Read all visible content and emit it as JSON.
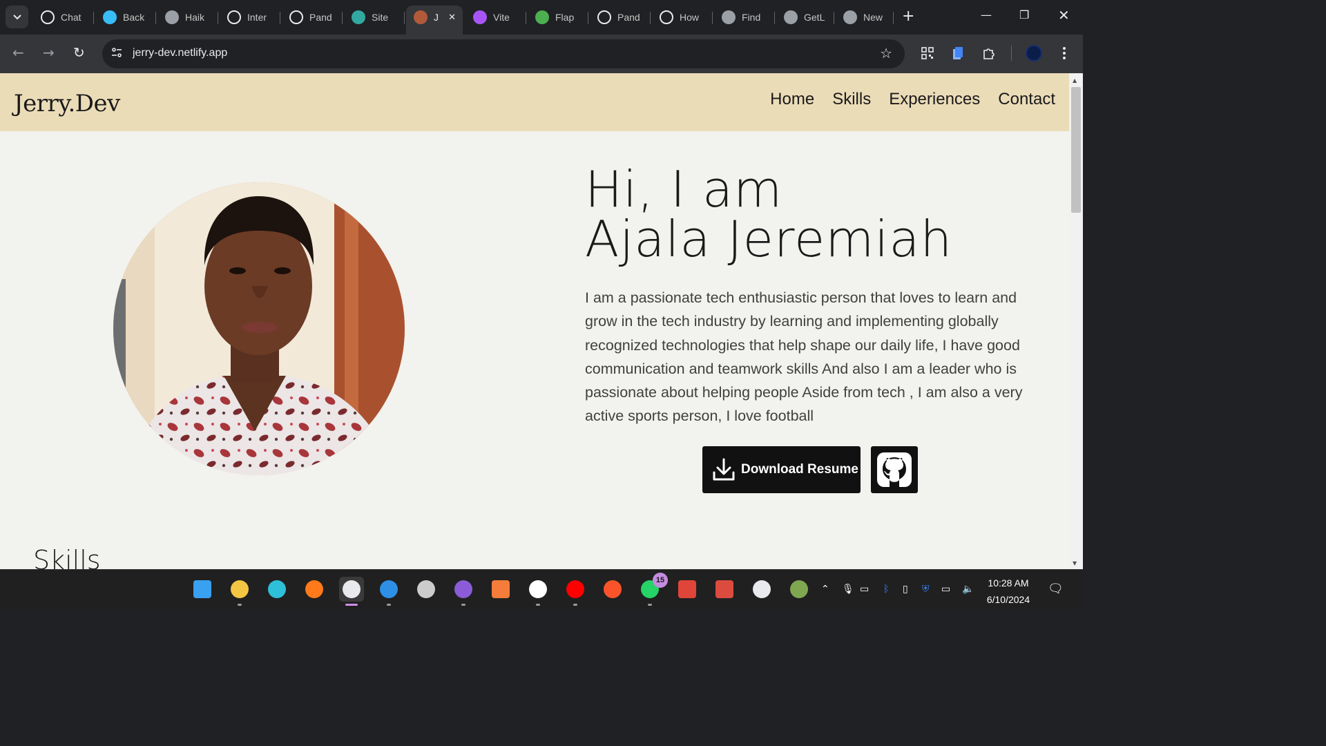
{
  "browser": {
    "tabs": [
      {
        "label": "Chat",
        "icon": "chatgpt-icon",
        "color": "#ffffff"
      },
      {
        "label": "Back",
        "icon": "tailwind-icon",
        "color": "#38bdf8"
      },
      {
        "label": "Haik",
        "icon": "globe-icon",
        "color": "#9aa0a6"
      },
      {
        "label": "Inter",
        "icon": "medium-icon",
        "color": "#ffffff"
      },
      {
        "label": "Pand",
        "icon": "panda-icon",
        "color": "#ffffff"
      },
      {
        "label": "Site",
        "icon": "netlify-icon",
        "color": "#32a8a1"
      },
      {
        "label": "J",
        "icon": "profile-photo-icon",
        "color": "#b05a3a"
      },
      {
        "label": "Vite",
        "icon": "vite-icon",
        "color": "#a855f7"
      },
      {
        "label": "Flap",
        "icon": "game-icon",
        "color": "#4caf50"
      },
      {
        "label": "Pand",
        "icon": "panda-icon",
        "color": "#ffffff"
      },
      {
        "label": "How",
        "icon": "medium-icon",
        "color": "#ffffff"
      },
      {
        "label": "Find",
        "icon": "globe-icon",
        "color": "#9aa0a6"
      },
      {
        "label": "GetL",
        "icon": "globe-icon",
        "color": "#9aa0a6"
      },
      {
        "label": "New",
        "icon": "chrome-icon",
        "color": "#9aa0a6"
      }
    ],
    "active_tab_index": 6,
    "url": "jerry-dev.netlify.app"
  },
  "site": {
    "brand": "Jerry.Dev",
    "nav": [
      "Home",
      "Skills",
      "Experiences",
      "Contact"
    ],
    "hero": {
      "line1": "Hi, I am",
      "line2": "Ajala Jeremiah",
      "bio": "I am a passionate tech enthusiastic person that loves to learn and grow in the tech industry by learning and implementing globally recognized technologies that help shape our daily life, I have good communication and teamwork skills And also I am a leader who is passionate about helping people Aside from tech , I am also a very active sports person, I love football",
      "resume_button": "Download Resume"
    },
    "skills_heading": "Skills",
    "colors": {
      "header_bg": "#ebdcb8",
      "page_bg": "#f2f2ee",
      "button_bg": "#111111"
    }
  },
  "taskbar": {
    "apps": [
      {
        "name": "start-icon",
        "color": "#3aa0f0"
      },
      {
        "name": "file-explorer-icon",
        "color": "#f4c542"
      },
      {
        "name": "edge-icon",
        "color": "#2ec0d8"
      },
      {
        "name": "firefox-icon",
        "color": "#ff7a1a"
      },
      {
        "name": "chrome-icon",
        "color": "#e8eaed"
      },
      {
        "name": "vscode-icon",
        "color": "#2d8fe6"
      },
      {
        "name": "terminal-icon",
        "color": "#cccccc"
      },
      {
        "name": "github-desktop-icon",
        "color": "#8a5cd8"
      },
      {
        "name": "xampp-icon",
        "color": "#f57c3a"
      },
      {
        "name": "github-icon",
        "color": "#ffffff"
      },
      {
        "name": "youtube-icon",
        "color": "#ff0000"
      },
      {
        "name": "brave-icon",
        "color": "#fb542b"
      },
      {
        "name": "whatsapp-icon",
        "color": "#25d366"
      },
      {
        "name": "stack-icon",
        "color": "#e0453a"
      },
      {
        "name": "todo-icon",
        "color": "#db4c3f"
      },
      {
        "name": "chrome-icon",
        "color": "#e8eaed"
      },
      {
        "name": "chess-icon",
        "color": "#7fa650"
      }
    ],
    "whatsapp_badge": "15",
    "time": "10:28 AM",
    "date": "6/10/2024"
  }
}
